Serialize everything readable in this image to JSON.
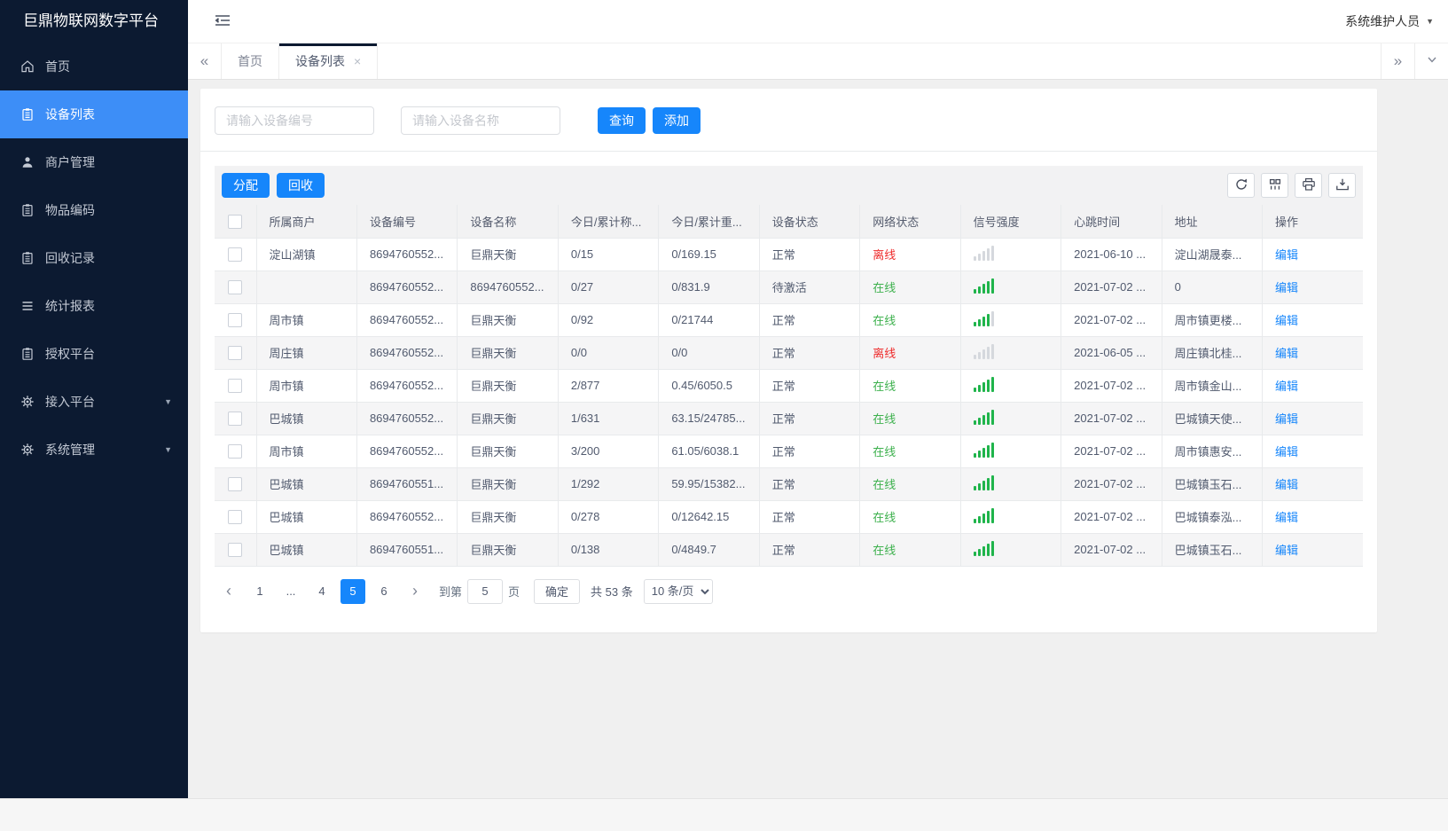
{
  "app": {
    "title": "巨鼎物联网数字平台",
    "user_role": "系统维护人员"
  },
  "colors": {
    "primary": "#1686fb",
    "sidebar_bg": "#0c1a31",
    "sidebar_active": "#3d8ef7",
    "online_green": "#3eb14e",
    "offline_red": "#ee2c2c",
    "signal_green": "#1fb44b"
  },
  "icons": {
    "double_chevron_left": "«",
    "double_chevron_right": "»",
    "chevron_left": "‹",
    "chevron_right": "›",
    "caret_down": "▼",
    "close": "×"
  },
  "sidebar": {
    "items": [
      {
        "id": "home",
        "label": "首页",
        "icon": "home-icon",
        "active": false,
        "expandable": false
      },
      {
        "id": "device-list",
        "label": "设备列表",
        "icon": "clipboard-icon",
        "active": true,
        "expandable": false
      },
      {
        "id": "merchant-management",
        "label": "商户管理",
        "icon": "user-icon",
        "active": false,
        "expandable": false
      },
      {
        "id": "item-code",
        "label": "物品编码",
        "icon": "clipboard-icon",
        "active": false,
        "expandable": false
      },
      {
        "id": "recycle-records",
        "label": "回收记录",
        "icon": "clipboard-icon",
        "active": false,
        "expandable": false
      },
      {
        "id": "statistics-report",
        "label": "统计报表",
        "icon": "list-icon",
        "active": false,
        "expandable": false
      },
      {
        "id": "authorization-platform",
        "label": "授权平台",
        "icon": "clipboard-icon",
        "active": false,
        "expandable": false
      },
      {
        "id": "access-platform",
        "label": "接入平台",
        "icon": "gear-icon",
        "active": false,
        "expandable": true
      },
      {
        "id": "system-management",
        "label": "系统管理",
        "icon": "gear-icon",
        "active": false,
        "expandable": true
      }
    ]
  },
  "tabs": [
    {
      "label": "首页",
      "active": false,
      "closable": false
    },
    {
      "label": "设备列表",
      "active": true,
      "closable": true
    }
  ],
  "search": {
    "device_no_placeholder": "请输入设备编号",
    "device_name_placeholder": "请输入设备名称",
    "query_button": "查询",
    "add_button": "添加"
  },
  "toolbar": {
    "assign_button": "分配",
    "recycle_button": "回收"
  },
  "table": {
    "headers": [
      "所属商户",
      "设备编号",
      "设备名称",
      "今日/累计称...",
      "今日/累计重...",
      "设备状态",
      "网络状态",
      "信号强度",
      "心跳时间",
      "地址",
      "操作"
    ],
    "edit_label": "编辑",
    "rows": [
      {
        "merchant": "淀山湖镇",
        "device_no": "8694760552...",
        "device_name": "巨鼎天衡",
        "today_total_count": "0/15",
        "today_total_weight": "0/169.15",
        "device_status": "正常",
        "network_status": "离线",
        "signal_level": 0,
        "heartbeat": "2021-06-10 ...",
        "address": "淀山湖晟泰..."
      },
      {
        "merchant": "",
        "device_no": "8694760552...",
        "device_name": "8694760552...",
        "today_total_count": "0/27",
        "today_total_weight": "0/831.9",
        "device_status": "待激活",
        "network_status": "在线",
        "signal_level": 5,
        "heartbeat": "2021-07-02 ...",
        "address": "0"
      },
      {
        "merchant": "周市镇",
        "device_no": "8694760552...",
        "device_name": "巨鼎天衡",
        "today_total_count": "0/92",
        "today_total_weight": "0/21744",
        "device_status": "正常",
        "network_status": "在线",
        "signal_level": 4,
        "heartbeat": "2021-07-02 ...",
        "address": "周市镇更楼..."
      },
      {
        "merchant": "周庄镇",
        "device_no": "8694760552...",
        "device_name": "巨鼎天衡",
        "today_total_count": "0/0",
        "today_total_weight": "0/0",
        "device_status": "正常",
        "network_status": "离线",
        "signal_level": 0,
        "heartbeat": "2021-06-05 ...",
        "address": "周庄镇北桂..."
      },
      {
        "merchant": "周市镇",
        "device_no": "8694760552...",
        "device_name": "巨鼎天衡",
        "today_total_count": "2/877",
        "today_total_weight": "0.45/6050.5",
        "device_status": "正常",
        "network_status": "在线",
        "signal_level": 5,
        "heartbeat": "2021-07-02 ...",
        "address": "周市镇金山..."
      },
      {
        "merchant": "巴城镇",
        "device_no": "8694760552...",
        "device_name": "巨鼎天衡",
        "today_total_count": "1/631",
        "today_total_weight": "63.15/24785...",
        "device_status": "正常",
        "network_status": "在线",
        "signal_level": 5,
        "heartbeat": "2021-07-02 ...",
        "address": "巴城镇天使..."
      },
      {
        "merchant": "周市镇",
        "device_no": "8694760552...",
        "device_name": "巨鼎天衡",
        "today_total_count": "3/200",
        "today_total_weight": "61.05/6038.1",
        "device_status": "正常",
        "network_status": "在线",
        "signal_level": 5,
        "heartbeat": "2021-07-02 ...",
        "address": "周市镇惠安..."
      },
      {
        "merchant": "巴城镇",
        "device_no": "8694760551...",
        "device_name": "巨鼎天衡",
        "today_total_count": "1/292",
        "today_total_weight": "59.95/15382...",
        "device_status": "正常",
        "network_status": "在线",
        "signal_level": 5,
        "heartbeat": "2021-07-02 ...",
        "address": "巴城镇玉石..."
      },
      {
        "merchant": "巴城镇",
        "device_no": "8694760552...",
        "device_name": "巨鼎天衡",
        "today_total_count": "0/278",
        "today_total_weight": "0/12642.15",
        "device_status": "正常",
        "network_status": "在线",
        "signal_level": 5,
        "heartbeat": "2021-07-02 ...",
        "address": "巴城镇泰泓..."
      },
      {
        "merchant": "巴城镇",
        "device_no": "8694760551...",
        "device_name": "巨鼎天衡",
        "today_total_count": "0/138",
        "today_total_weight": "0/4849.7",
        "device_status": "正常",
        "network_status": "在线",
        "signal_level": 5,
        "heartbeat": "2021-07-02 ...",
        "address": "巴城镇玉石..."
      }
    ]
  },
  "pagination": {
    "pages": [
      "1",
      "...",
      "4",
      "5",
      "6"
    ],
    "active_page": "5",
    "goto_label": "到第",
    "goto_value": "5",
    "page_unit_label": "页",
    "confirm_button": "确定",
    "total_text": "共 53 条",
    "page_size_option": "10 条/页"
  }
}
